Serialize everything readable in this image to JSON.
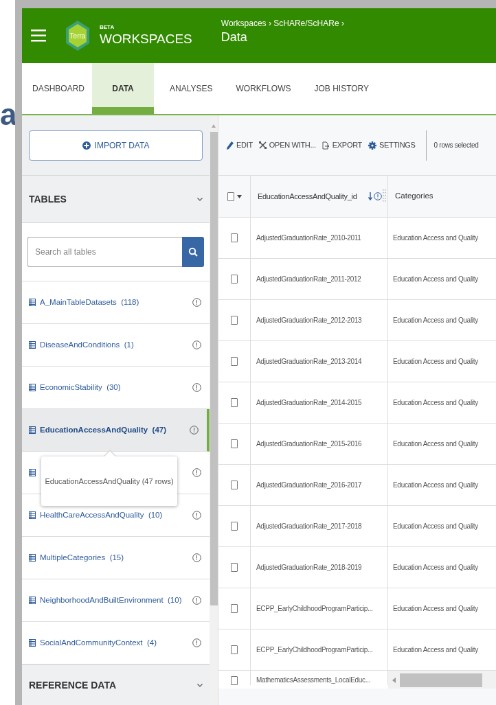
{
  "background_text": "a",
  "header": {
    "logo_text": "Terra",
    "beta_badge": "BETA",
    "app_name": "WORKSPACES",
    "breadcrumb": "Workspaces › ScHARe/ScHARe ›",
    "page_title": "Data"
  },
  "tabs": [
    {
      "label": "DASHBOARD",
      "selected": false
    },
    {
      "label": "DATA",
      "selected": true
    },
    {
      "label": "ANALYSES",
      "selected": false
    },
    {
      "label": "WORKFLOWS",
      "selected": false
    },
    {
      "label": "JOB HISTORY",
      "selected": false
    }
  ],
  "sidebar": {
    "import_button": "IMPORT DATA",
    "tables_title": "TABLES",
    "search": {
      "placeholder": "Search all tables"
    },
    "tables": [
      {
        "name": "A_MainTableDatasets",
        "count": "(118)",
        "selected": false
      },
      {
        "name": "DiseaseAndConditions",
        "count": "(1)",
        "selected": false
      },
      {
        "name": "EconomicStability",
        "count": "(30)",
        "selected": false
      },
      {
        "name": "EducationAccessAndQuality",
        "count": "(47)",
        "selected": true
      },
      {
        "selected": false
      },
      {
        "name": "HealthCareAccessAndQuality",
        "count": "(10)",
        "selected": false
      },
      {
        "name": "MultipleCategories",
        "count": "(15)",
        "selected": false
      },
      {
        "name": "NeighborhoodAndBuiltEnvironment",
        "count": "(10)",
        "selected": false
      },
      {
        "name": "SocialAndCommunityContext",
        "count": "(4)",
        "selected": false
      }
    ],
    "tooltip": "EducationAccessAndQuality (47 rows)",
    "reference_title": "REFERENCE DATA"
  },
  "toolbar": {
    "actions": [
      {
        "kind": "edit",
        "label": "EDIT"
      },
      {
        "kind": "open",
        "label": "OPEN WITH..."
      },
      {
        "kind": "export",
        "label": "EXPORT"
      },
      {
        "kind": "settings",
        "label": "SETTINGS"
      }
    ],
    "selection_status": "0 rows selected"
  },
  "table": {
    "all_selected": false,
    "columns": [
      "EducationAccessAndQuality_id",
      "Categories"
    ],
    "rows": [
      {
        "checked": false,
        "cells": [
          "AdjustedGraduationRate_2010-2011",
          "Education Access and Quality"
        ]
      },
      {
        "checked": false,
        "cells": [
          "AdjustedGraduationRate_2011-2012",
          "Education Access and Quality"
        ]
      },
      {
        "checked": false,
        "cells": [
          "AdjustedGraduationRate_2012-2013",
          "Education Access and Quality"
        ]
      },
      {
        "checked": false,
        "cells": [
          "AdjustedGraduationRate_2013-2014",
          "Education Access and Quality"
        ]
      },
      {
        "checked": false,
        "cells": [
          "AdjustedGraduationRate_2014-2015",
          "Education Access and Quality"
        ]
      },
      {
        "checked": false,
        "cells": [
          "AdjustedGraduationRate_2015-2016",
          "Education Access and Quality"
        ]
      },
      {
        "checked": false,
        "cells": [
          "AdjustedGraduationRate_2016-2017",
          "Education Access and Quality"
        ]
      },
      {
        "checked": false,
        "cells": [
          "AdjustedGraduationRate_2017-2018",
          "Education Access and Quality"
        ]
      },
      {
        "checked": false,
        "cells": [
          "AdjustedGraduationRate_2018-2019",
          "Education Access and Quality"
        ]
      },
      {
        "checked": false,
        "cells": [
          "ECPP_EarlyChildhoodProgramParticip...",
          "Education Access and Quality"
        ]
      },
      {
        "checked": false,
        "cells": [
          "ECPP_EarlyChildhoodProgramParticip...",
          "Education Access and Quality"
        ]
      },
      {
        "checked": false,
        "cells": [
          "MathematicsAssessments_LocalEduc..."
        ]
      }
    ]
  }
}
